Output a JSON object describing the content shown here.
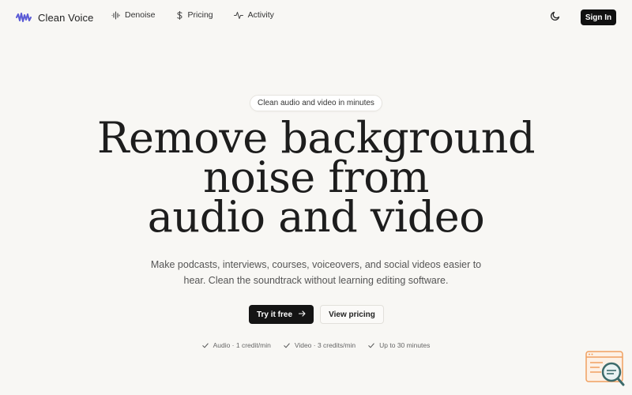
{
  "header": {
    "brand_name": "Clean Voice",
    "nav": [
      {
        "label": "Denoise",
        "icon": "waveform-icon"
      },
      {
        "label": "Pricing",
        "icon": "dollar-icon"
      },
      {
        "label": "Activity",
        "icon": "activity-icon"
      }
    ],
    "theme_icon": "moon-icon",
    "signin_label": "Sign In"
  },
  "hero": {
    "pill": "Clean audio and video in minutes",
    "headline": [
      "Remove background",
      "noise from",
      "audio and video"
    ],
    "subtitle": "Make podcasts, interviews, courses, voiceovers, and social videos easier to hear. Clean the soundtrack without learning editing software.",
    "cta_primary": "Try it free",
    "cta_secondary": "View pricing",
    "features": [
      "Audio · 1 credit/min",
      "Video · 3 credits/min",
      "Up to 30 minutes"
    ]
  },
  "colors": {
    "background": "#f8f7f4",
    "brand_accent": "#5b5bd6",
    "primary_button": "#141414",
    "widget_orange": "#f0a060",
    "widget_teal": "#3c6b6b"
  }
}
